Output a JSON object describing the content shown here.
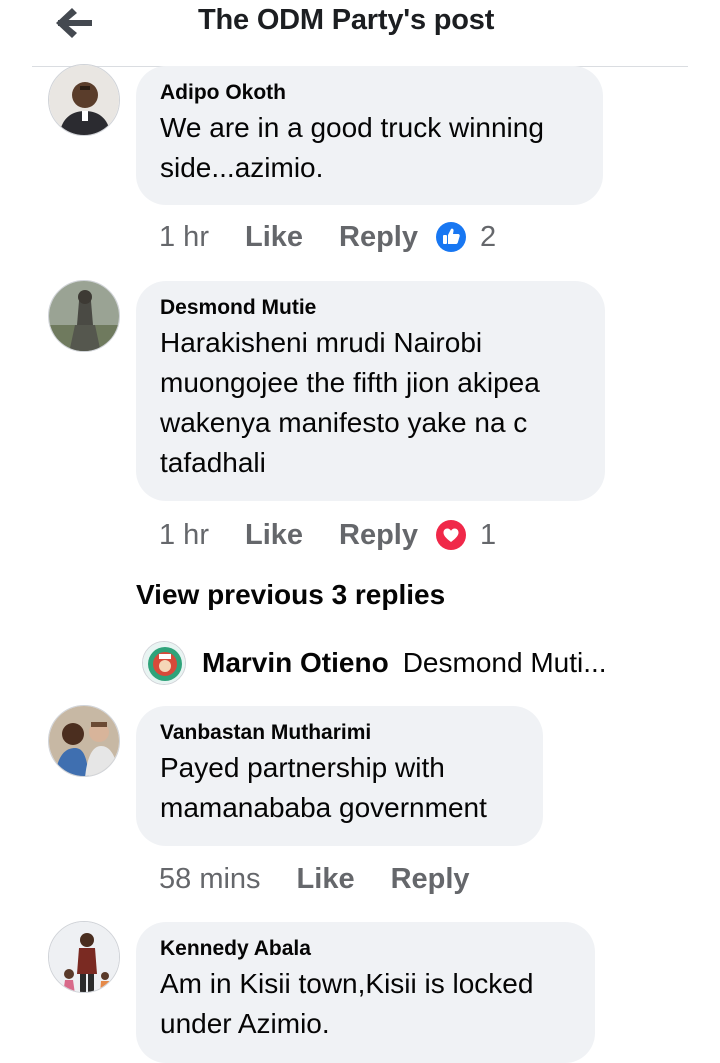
{
  "header": {
    "title": "The ODM Party's post",
    "back_icon": "arrow-left-icon"
  },
  "comments": [
    {
      "author": "Adipo Okoth",
      "lines": [
        "We are in a good truck winning",
        "side...azimio."
      ],
      "time": "1 hr",
      "like_label": "Like",
      "reply_label": "Reply",
      "reaction": "like",
      "reaction_color": "#1877f2",
      "reaction_count": "2"
    },
    {
      "author": "Desmond Mutie",
      "lines": [
        "Harakisheni mrudi Nairobi",
        "muongojee the fifth jion akipea",
        "wakenya manifesto yake na c",
        "tafadhali"
      ],
      "time": "1 hr",
      "like_label": "Like",
      "reply_label": "Reply",
      "reaction": "love",
      "reaction_color": "#f02849",
      "reaction_count": "1"
    },
    {
      "author": "Vanbastan Mutharimi",
      "lines": [
        "Payed partnership with",
        "mamanababa government"
      ],
      "time": "58 mins",
      "like_label": "Like",
      "reply_label": "Reply"
    },
    {
      "author": "Kennedy Abala",
      "lines": [
        "Am in Kisii town,Kisii is locked",
        "under Azimio."
      ]
    }
  ],
  "view_previous": "View previous 3 replies",
  "reply_preview": {
    "name": "Marvin Otieno",
    "text": "Desmond Muti..."
  },
  "colors": {
    "bubble": "#f0f2f5",
    "secondary_text": "#65676b",
    "like_blue": "#1877f2",
    "love_red": "#f02849"
  }
}
